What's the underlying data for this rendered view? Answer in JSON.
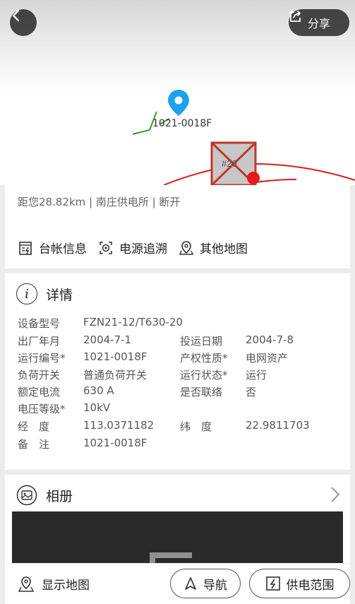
{
  "map": {
    "marker_label": "1021-0018F",
    "box_label": "#20",
    "share_label": "分享"
  },
  "info": {
    "distance_line": "距您28.82km | 南庄供电所 | 断开",
    "actions": [
      {
        "label": "台帐信息",
        "icon": "ledger-icon"
      },
      {
        "label": "电源追溯",
        "icon": "trace-icon"
      },
      {
        "label": "其他地图",
        "icon": "map-pin-icon"
      }
    ]
  },
  "details": {
    "title": "详情",
    "fields": [
      {
        "key": "设备型号",
        "value": "FZN21-12/T630-20"
      },
      {
        "key": "出厂年月",
        "value": "2004-7-1"
      },
      {
        "key": "投运日期",
        "value": "2004-7-8"
      },
      {
        "key": "运行编号*",
        "value": "1021-0018F"
      },
      {
        "key": "产权性质*",
        "value": "电网资产"
      },
      {
        "key": "负荷开关",
        "value": "普通负荷开关"
      },
      {
        "key": "运行状态*",
        "value": "运行"
      },
      {
        "key": "额定电流",
        "value": "630 A"
      },
      {
        "key": "是否联络",
        "value": "否"
      },
      {
        "key": "电压等级*",
        "value": "10kV"
      },
      {
        "key": "经　度",
        "value": "113.0371182"
      },
      {
        "key": "纬　度",
        "value": "22.9811703"
      },
      {
        "key": "备　注",
        "value": "1021-0018F"
      }
    ]
  },
  "album": {
    "title": "相册"
  },
  "bottom": {
    "show_map": "显示地图",
    "navigate": "导航",
    "supply_range": "供电范围"
  }
}
